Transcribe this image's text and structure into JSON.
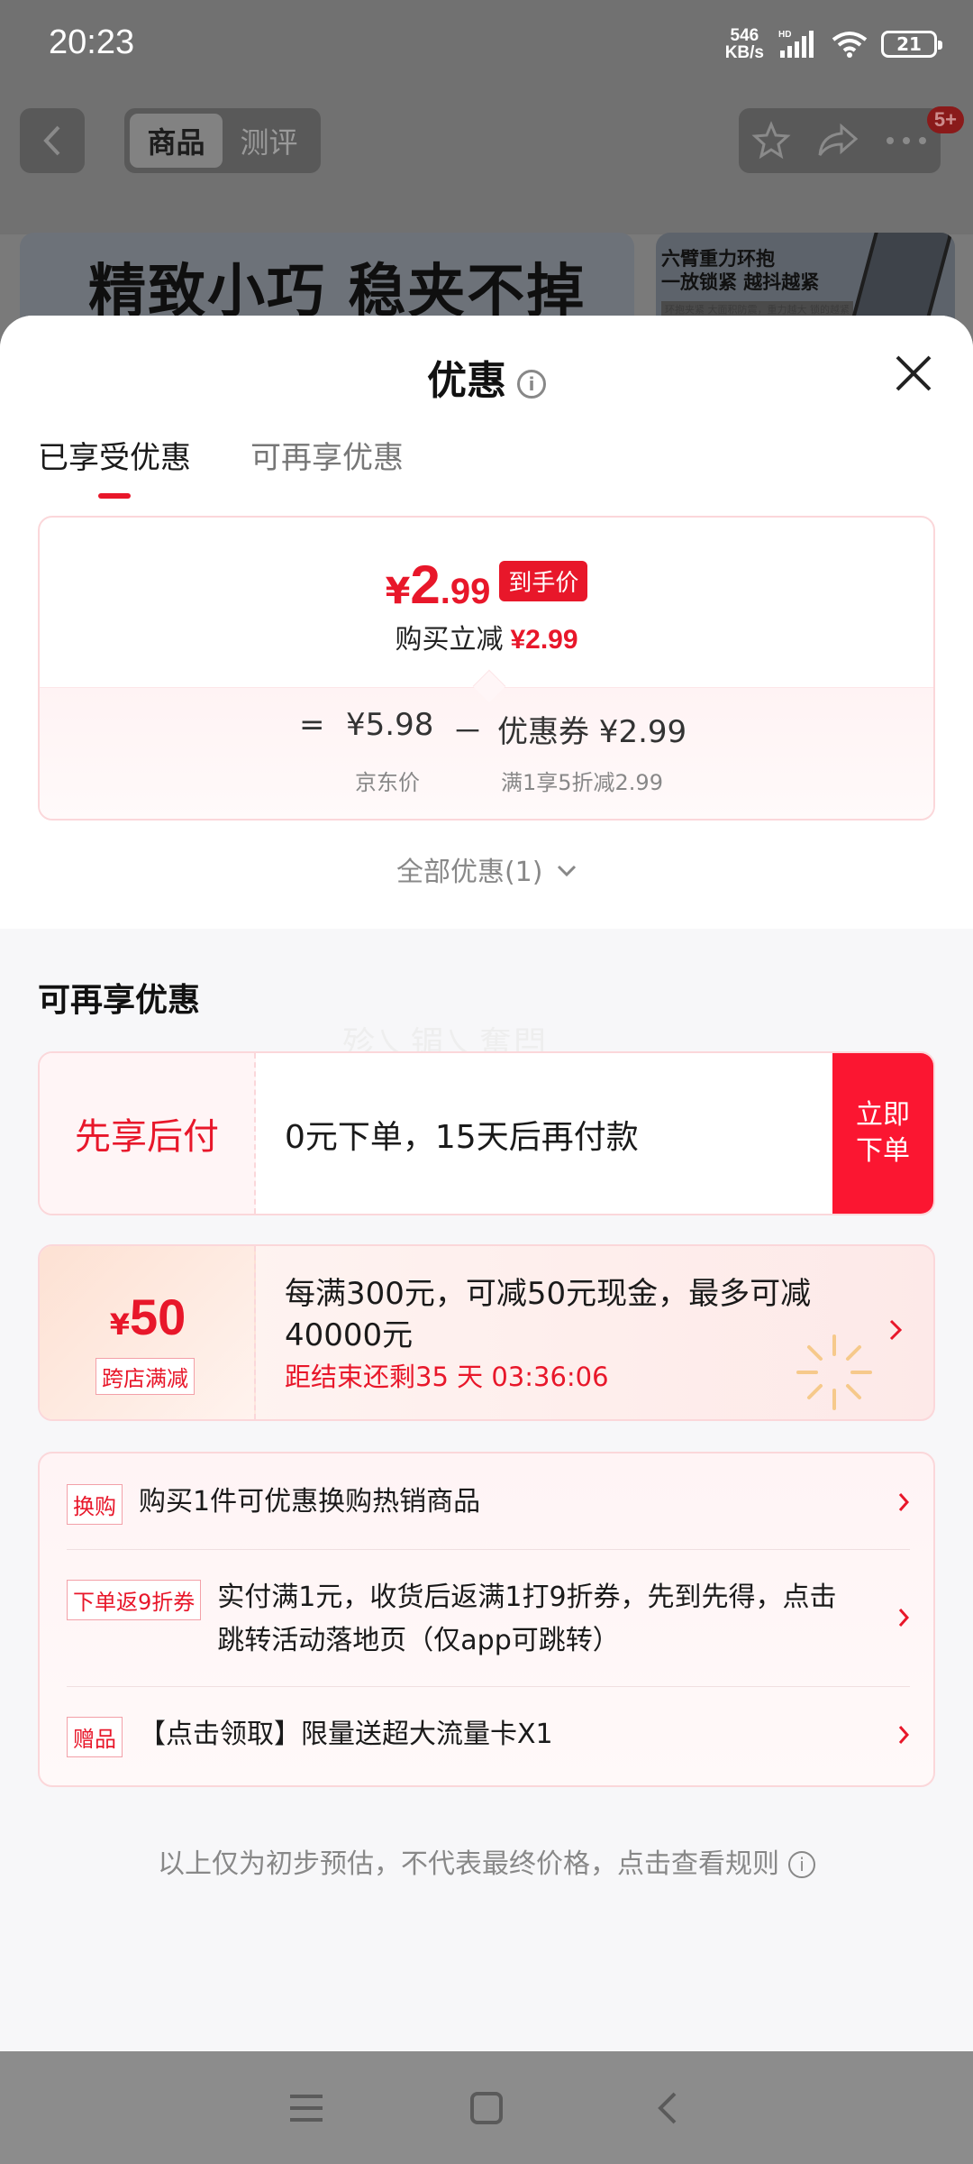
{
  "status_bar": {
    "time": "20:23",
    "net_speed_value": "546",
    "net_speed_unit": "KB/s",
    "hd_label": "HD",
    "battery": "21"
  },
  "header": {
    "tabs": [
      {
        "label": "商品",
        "active": true
      },
      {
        "label": "测评",
        "active": false
      }
    ],
    "badge": "5+"
  },
  "banner": {
    "left_text": "精致小巧 稳夹不掉",
    "right_line1": "六臂重力环抱",
    "right_line2": "一放锁紧 越抖越紧",
    "right_small": "环抱夹紧 大面积防震，重力越大 锁的越紧"
  },
  "sheet": {
    "title": "优惠",
    "info_icon": "info-icon",
    "tabs": [
      {
        "label": "已享受优惠",
        "active": true
      },
      {
        "label": "可再享优惠",
        "active": false
      }
    ],
    "price": {
      "yen": "¥",
      "int": "2",
      "dec": ".99",
      "tag": "到手价",
      "discount_label": "购买立减",
      "discount_value": "¥2.99"
    },
    "formula": {
      "eq": "=",
      "jd_price": "¥5.98",
      "minus": "－",
      "coupon": "优惠券 ¥2.99",
      "jd_label": "京东价",
      "coupon_label": "满1享5折减2.99"
    },
    "all_discounts": "全部优惠(1)",
    "section_title": "可再享优惠",
    "watermark": "殄乀镅乀奮閂",
    "pay_later": {
      "title": "先享后付",
      "desc": "0元下单，15天后再付款",
      "button_line1": "立即",
      "button_line2": "下单"
    },
    "cross_store": {
      "yen": "¥",
      "amount": "50",
      "label": "跨店满减",
      "desc": "每满300元，可减50元现金，最多可减40000元",
      "countdown": "距结束还剩35 天 03:36:06"
    },
    "misc_rows": [
      {
        "tag": "换购",
        "text": "购买1件可优惠换购热销商品"
      },
      {
        "tag": "下单返9折券",
        "text": "实付满1元，收货后返满1打9折券，先到先得，点击跳转活动落地页（仅app可跳转）"
      },
      {
        "tag": "赠品",
        "text": "【点击领取】限量送超大流量卡X1"
      }
    ],
    "footer_note": "以上仅为初步预估，不代表最终价格，点击查看规则"
  },
  "colors": {
    "accent": "#e8172a",
    "button_red": "#fb1631"
  }
}
